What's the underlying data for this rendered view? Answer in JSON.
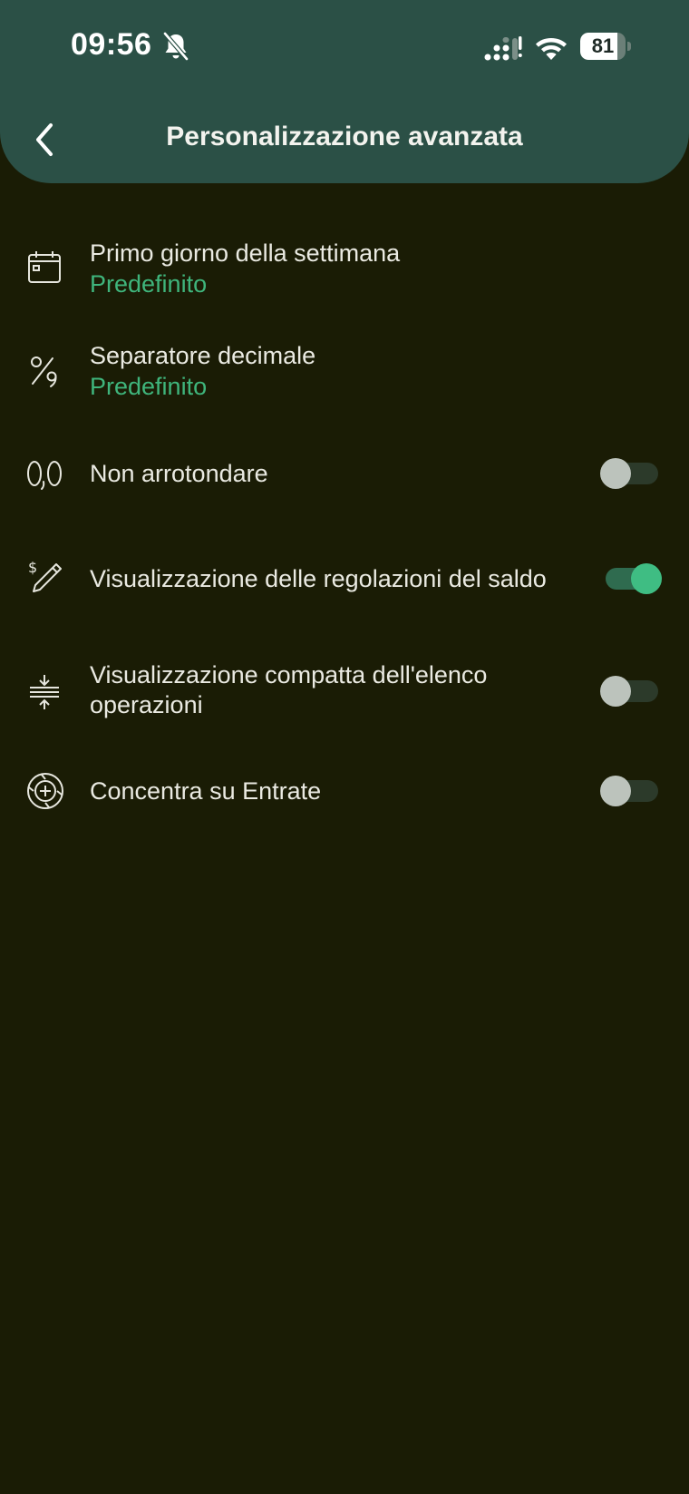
{
  "status_bar": {
    "time": "09:56",
    "battery": "81",
    "battery_level": 0.81
  },
  "header": {
    "title": "Personalizzazione avanzata"
  },
  "settings": [
    {
      "label": "Primo giorno della settimana",
      "value": "Predefinito",
      "icon": "calendar-icon"
    },
    {
      "label": "Separatore decimale",
      "value": "Predefinito",
      "icon": "decimal-separator-icon"
    },
    {
      "label": "Non arrotondare",
      "toggle": false,
      "icon": "zero-comma-zero-icon"
    },
    {
      "label": "Visualizzazione delle regolazioni del saldo",
      "toggle": true,
      "icon": "dollar-pencil-icon"
    },
    {
      "label_line1": "Visualizzazione compatta dell'elenco",
      "label_line2": "operazioni",
      "toggle": false,
      "icon": "compact-list-icon"
    },
    {
      "label": "Concentra su Entrate",
      "toggle": false,
      "icon": "plus-circle-icon"
    }
  ],
  "colors": {
    "header_bg": "#2b5046",
    "page_bg": "#1a1c05",
    "accent": "#3fb57c"
  }
}
